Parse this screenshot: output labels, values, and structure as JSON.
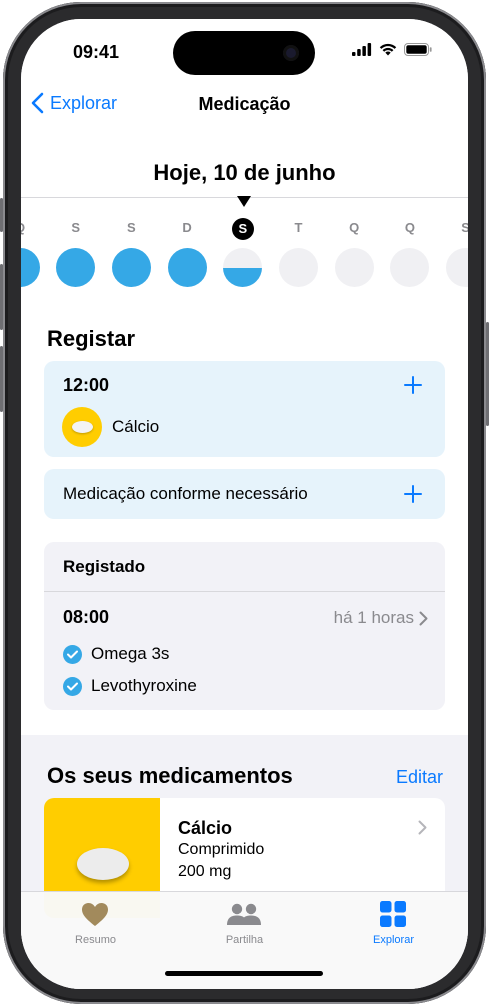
{
  "status_bar": {
    "time": "09:41"
  },
  "nav": {
    "back_label": "Explorar",
    "title": "Medicação"
  },
  "date_heading": "Hoje, 10 de junho",
  "week": {
    "letters": [
      "Q",
      "S",
      "S",
      "D",
      "S",
      "T",
      "Q",
      "Q",
      "S"
    ],
    "today_index": 4,
    "completion": [
      1,
      1,
      1,
      1,
      0.5,
      0,
      0,
      0,
      0
    ]
  },
  "register_section": {
    "title": "Registar",
    "scheduled": {
      "time": "12:00",
      "medication": "Cálcio"
    },
    "as_needed_label": "Medicação conforme necessário"
  },
  "logged_section": {
    "title": "Registado",
    "time": "08:00",
    "ago": "há 1 horas",
    "items": [
      "Omega 3s",
      "Levothyroxine"
    ]
  },
  "your_meds": {
    "title": "Os seus medicamentos",
    "edit_label": "Editar",
    "card": {
      "name": "Cálcio",
      "form": "Comprimido",
      "dose": "200 mg"
    }
  },
  "tabbar": {
    "items": [
      {
        "label": "Resumo",
        "icon": "heart-icon"
      },
      {
        "label": "Partilha",
        "icon": "people-icon"
      },
      {
        "label": "Explorar",
        "icon": "grid-icon"
      }
    ],
    "active_index": 2
  },
  "colors": {
    "accent": "#0a7aff",
    "medication_blue": "#35a8e6",
    "pill_yellow": "#ffcd00",
    "card_blue": "#e6f3fb",
    "tab_inactive": "#8a8a8e",
    "heart": "#a28a5c"
  }
}
